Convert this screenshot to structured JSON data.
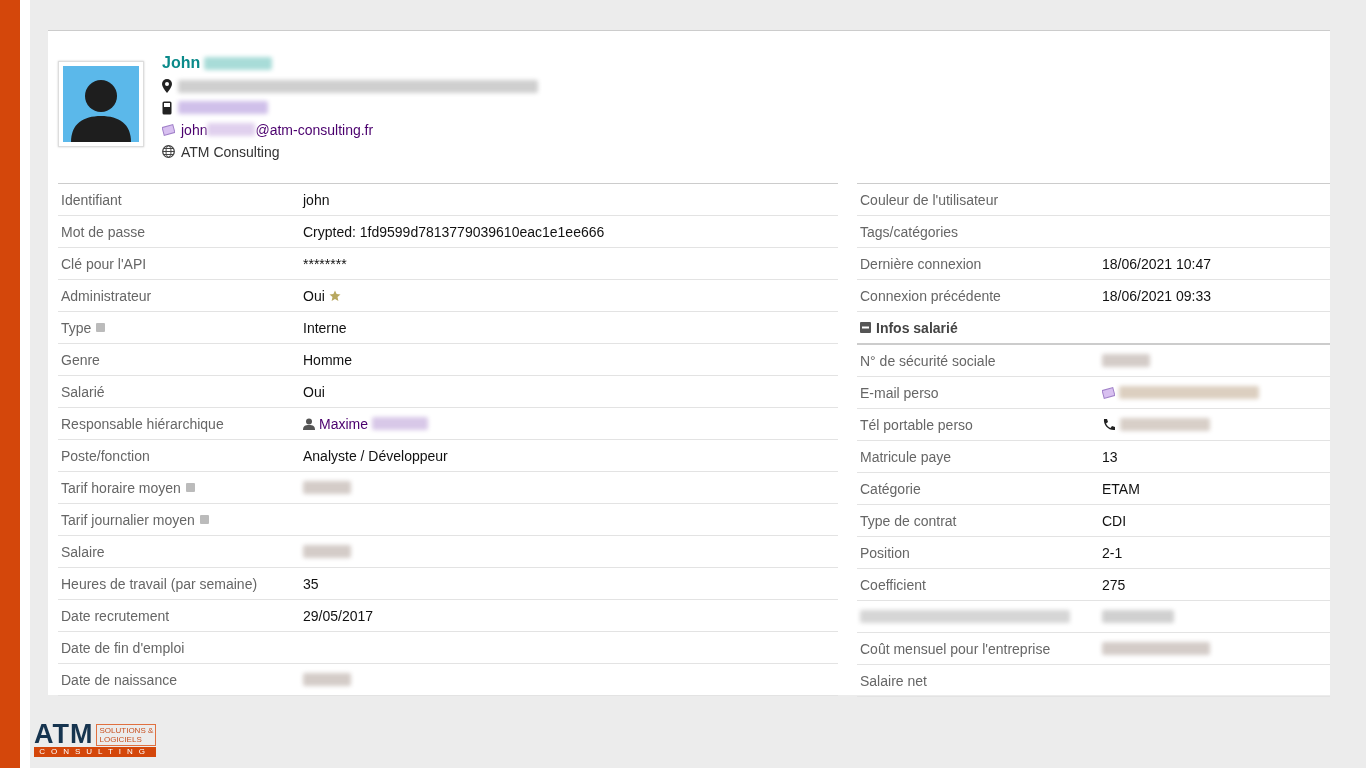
{
  "profile": {
    "first_name": "John",
    "email_start": "john",
    "email_end": "@atm-consulting.fr",
    "company": "ATM Consulting"
  },
  "left_rows": [
    {
      "label": "Identifiant",
      "kind": "text",
      "value": "john",
      "help": false
    },
    {
      "label": "Mot de passe",
      "kind": "text",
      "value": "Crypted: 1fd9599d7813779039610eac1e1ee666",
      "help": false
    },
    {
      "label": "Clé pour l'API",
      "kind": "text",
      "value": "********",
      "help": false
    },
    {
      "label": "Administrateur",
      "kind": "starred",
      "value": "Oui",
      "help": false
    },
    {
      "label": "Type",
      "kind": "text",
      "value": "Interne",
      "help": true
    },
    {
      "label": "Genre",
      "kind": "text",
      "value": "Homme",
      "help": false
    },
    {
      "label": "Salarié",
      "kind": "text",
      "value": "Oui",
      "help": false
    },
    {
      "label": "Responsable hiérarchique",
      "kind": "person",
      "value": "Maxime",
      "help": false
    },
    {
      "label": "Poste/fonction",
      "kind": "text",
      "value": "Analyste / Développeur",
      "help": false
    },
    {
      "label": "Tarif horaire moyen",
      "kind": "blurred",
      "help": true
    },
    {
      "label": "Tarif journalier moyen",
      "kind": "empty",
      "help": true
    },
    {
      "label": "Salaire",
      "kind": "blurred",
      "help": false
    },
    {
      "label": "Heures de travail (par semaine)",
      "kind": "text",
      "value": "35",
      "help": false
    },
    {
      "label": "Date recrutement",
      "kind": "text",
      "value": "29/05/2017",
      "help": false
    },
    {
      "label": "Date de fin d'emploi",
      "kind": "empty",
      "help": false
    },
    {
      "label": "Date de naissance",
      "kind": "blurred",
      "help": false
    }
  ],
  "right_rows": [
    {
      "label": "Couleur de l'utilisateur",
      "kind": "empty"
    },
    {
      "label": "Tags/catégories",
      "kind": "empty"
    },
    {
      "label": "Dernière connexion",
      "kind": "text",
      "value": "18/06/2021 10:47"
    },
    {
      "label": "Connexion précédente",
      "kind": "text",
      "value": "18/06/2021 09:33"
    },
    {
      "label": "Infos salarié",
      "kind": "section",
      "expanded": true
    },
    {
      "label": "N° de sécurité sociale",
      "kind": "blurred"
    },
    {
      "label": "E-mail perso",
      "kind": "email_blurred"
    },
    {
      "label": "Tél portable perso",
      "kind": "phone_blurred"
    },
    {
      "label": "Matricule paye",
      "kind": "text",
      "value": "13"
    },
    {
      "label": "Catégorie",
      "kind": "text",
      "value": "ETAM"
    },
    {
      "label": "Type de contrat",
      "kind": "text",
      "value": "CDI"
    },
    {
      "label": "Position",
      "kind": "text",
      "value": "2-1"
    },
    {
      "label": "Coefficient",
      "kind": "text",
      "value": "275"
    },
    {
      "kind": "blurred_row"
    },
    {
      "label": "Coût mensuel pour l'entreprise",
      "kind": "blurred"
    },
    {
      "label": "Salaire net",
      "kind": "empty"
    }
  ],
  "logo": {
    "mark": "ATM",
    "tag_1": "SOLUTIONS &",
    "tag_2": "LOGICIELS",
    "sub": "CONSULTING"
  }
}
